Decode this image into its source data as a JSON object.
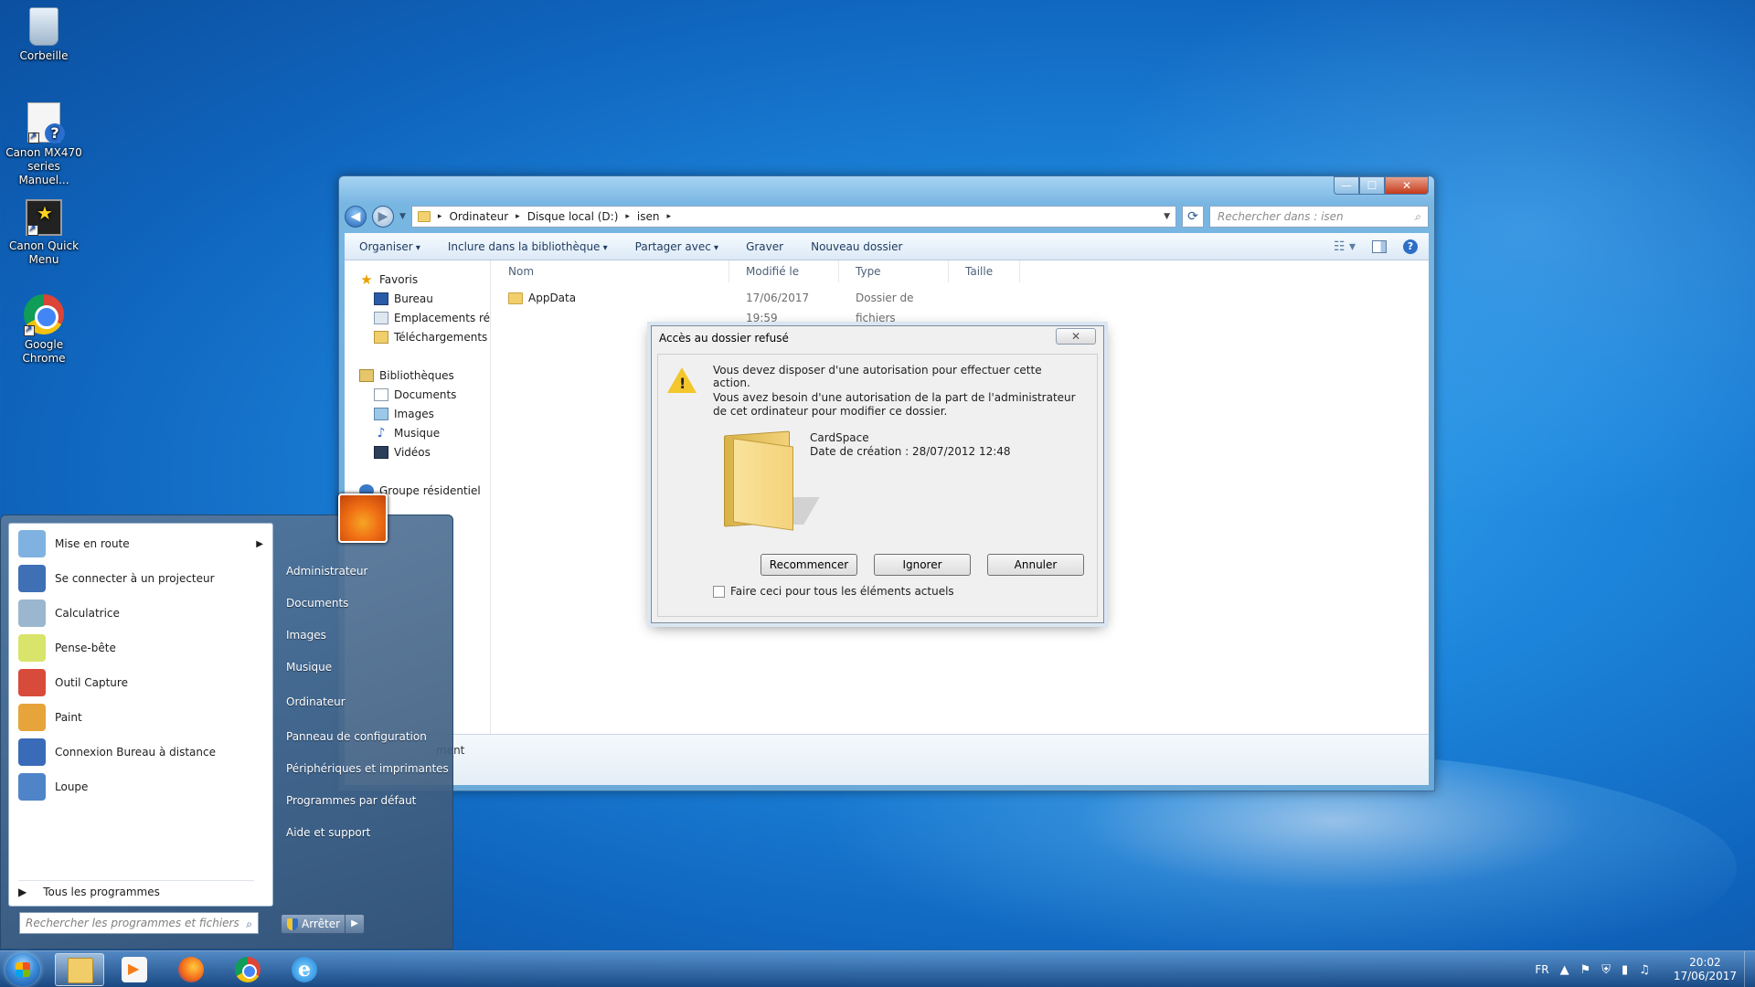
{
  "desktop": {
    "icons": [
      {
        "label": "Corbeille"
      },
      {
        "label": "Canon MX470 series Manuel..."
      },
      {
        "label": "Canon Quick Menu"
      },
      {
        "label": "Google Chrome"
      }
    ]
  },
  "explorer": {
    "controls": {
      "min": "—",
      "max": "☐",
      "close": "✕"
    },
    "address": {
      "crumbs": [
        "Ordinateur",
        "Disque local (D:)",
        "isen"
      ],
      "sep": "▸"
    },
    "search_placeholder": "Rechercher dans : isen",
    "toolbar": [
      "Organiser",
      "Inclure dans la bibliothèque",
      "Partager avec",
      "Graver",
      "Nouveau dossier"
    ],
    "navpane": {
      "favorites": {
        "label": "Favoris",
        "items": [
          "Bureau",
          "Emplacements récents",
          "Téléchargements"
        ]
      },
      "libraries": {
        "label": "Bibliothèques",
        "items": [
          "Documents",
          "Images",
          "Musique",
          "Vidéos"
        ]
      },
      "homegroup": "Groupe résidentiel"
    },
    "columns": [
      "Nom",
      "Modifié le",
      "Type",
      "Taille"
    ],
    "files": [
      {
        "name": "AppData",
        "modified": "17/06/2017 19:59",
        "type": "Dossier de fichiers",
        "size": ""
      }
    ],
    "details_text": "ment"
  },
  "dialog": {
    "title": "Accès au dossier refusé",
    "close": "✕",
    "message1": "Vous devez disposer d'une autorisation pour effectuer cette action.",
    "message2": "Vous avez besoin d'une autorisation de la part de l'administrateur de cet ordinateur pour modifier ce dossier.",
    "item_name": "CardSpace",
    "item_date": "Date de création : 28/07/2012 12:48",
    "buttons": {
      "retry": "Recommencer",
      "skip": "Ignorer",
      "cancel": "Annuler"
    },
    "checkbox_label": "Faire ceci pour tous les éléments actuels"
  },
  "start_menu": {
    "programs": [
      {
        "label": "Mise en route",
        "color": "#7fb2e0"
      },
      {
        "label": "Se connecter à un projecteur",
        "color": "#3f6fb5"
      },
      {
        "label": "Calculatrice",
        "color": "#9bb7cf"
      },
      {
        "label": "Pense-bête",
        "color": "#d9e46a"
      },
      {
        "label": "Outil Capture",
        "color": "#d84a3a"
      },
      {
        "label": "Paint",
        "color": "#e6a43a"
      },
      {
        "label": "Connexion Bureau à distance",
        "color": "#3a6bb8"
      },
      {
        "label": "Loupe",
        "color": "#4f84c9"
      }
    ],
    "all_programs": "Tous les programmes",
    "search_placeholder": "Rechercher les programmes et fichiers",
    "right_items": [
      "Administrateur",
      "Documents",
      "Images",
      "Musique",
      "Ordinateur",
      "Panneau de configuration",
      "Périphériques et imprimantes",
      "Programmes par défaut",
      "Aide et support"
    ],
    "shutdown": "Arrêter"
  },
  "taskbar": {
    "language": "FR",
    "time": "20:02",
    "date": "17/06/2017"
  }
}
